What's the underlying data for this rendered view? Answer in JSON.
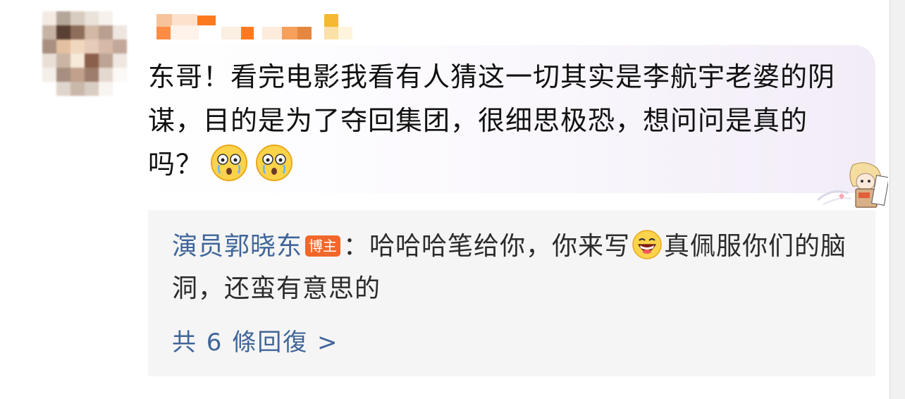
{
  "comment": {
    "avatar_icon": "pixelated-avatar",
    "username_icon": "pixelated-username",
    "text": "东哥！看完电影我看有人猜这一切其实是李航宇老婆的阴谋，目的是为了夺回集团，很细思极恐，想问问是真的吗？",
    "emojis": [
      "shocked-crying-emoji",
      "shocked-crying-emoji"
    ],
    "sticker_icon": "anime-character-sticker"
  },
  "reply": {
    "author": "演员郭晓东",
    "badge": "博主",
    "colon": "：",
    "text_before_emoji": "哈哈哈笔给你，你来写",
    "emoji": "grinning-emoji",
    "text_after_emoji": "真佩服你们的脑洞，还蛮有意思的"
  },
  "view_replies": {
    "label": "共 6 條回復 >"
  },
  "colors": {
    "link": "#406599",
    "badge": "#f2682a",
    "reply_background": "#f5f5f5"
  }
}
